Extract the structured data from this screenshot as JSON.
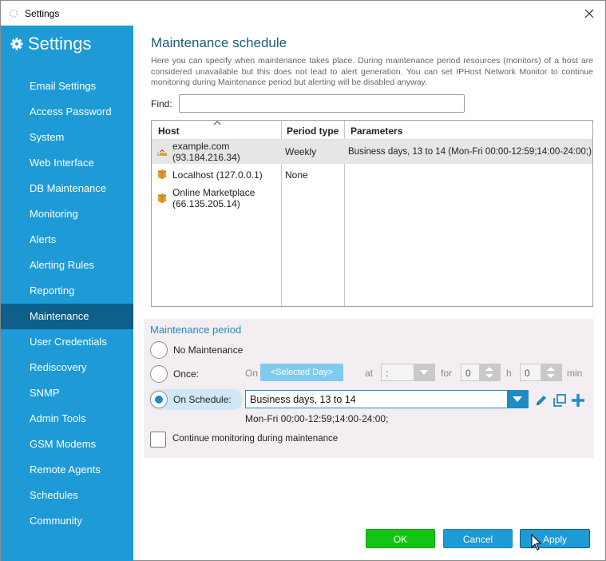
{
  "window": {
    "title": "Settings"
  },
  "sidebar": {
    "title": "Settings",
    "items": [
      {
        "label": "Email Settings"
      },
      {
        "label": "Access Password"
      },
      {
        "label": "System"
      },
      {
        "label": "Web Interface"
      },
      {
        "label": "DB Maintenance"
      },
      {
        "label": "Monitoring"
      },
      {
        "label": "Alerts"
      },
      {
        "label": "Alerting Rules"
      },
      {
        "label": "Reporting"
      },
      {
        "label": "Maintenance",
        "active": true
      },
      {
        "label": "User Credentials"
      },
      {
        "label": "Rediscovery"
      },
      {
        "label": "SNMP"
      },
      {
        "label": "Admin Tools"
      },
      {
        "label": "GSM Modems"
      },
      {
        "label": "Remote Agents"
      },
      {
        "label": "Schedules"
      },
      {
        "label": "Community"
      }
    ]
  },
  "main": {
    "heading": "Maintenance schedule",
    "description": "Here you can specify when maintenance takes place. During maintenance period resources (monitors) of a host are considered unavailable but this does not lead to alert generation. You can set IPHost Network Monitor to continue monitoring during Maintenance period but alerting will be disabled anyway.",
    "find_label": "Find:",
    "find_value": "",
    "table": {
      "columns": [
        "Host",
        "Period type",
        "Parameters"
      ],
      "rows": [
        {
          "host_line1": "example.com",
          "host_line2": "(93.184.216.34)",
          "period_type": "Weekly",
          "parameters": "Business days, 13 to 14 (Mon-Fri 00:00-12:59;14:00-24:00;)",
          "icon": "host-network-icon",
          "selected": true
        },
        {
          "host_line1": "Localhost (127.0.0.1)",
          "host_line2": "",
          "period_type": "None",
          "parameters": "",
          "icon": "server-icon"
        },
        {
          "host_line1": "Online Marketplace",
          "host_line2": "(66.135.205.14)",
          "period_type": "",
          "parameters": "",
          "icon": "server-icon"
        }
      ]
    }
  },
  "period": {
    "title": "Maintenance period",
    "options": {
      "no_maintenance": "No Maintenance",
      "once": "Once:",
      "on_schedule": "On Schedule:"
    },
    "selected": "on_schedule",
    "once_on": "On",
    "once_day": "<Selected Day>",
    "once_at": "at",
    "once_time": ":",
    "once_for": "for",
    "hours_value": "0",
    "hours_unit": "h",
    "minutes_value": "0",
    "minutes_unit": "min",
    "schedule_value": "Business days, 13 to 14",
    "schedule_detail": "Mon-Fri 00:00-12:59;14:00-24:00;",
    "continue_label": "Continue monitoring during maintenance",
    "continue_checked": false
  },
  "buttons": {
    "ok": "OK",
    "cancel": "Cancel",
    "apply": "Apply"
  },
  "colors": {
    "accent": "#1e9ad6",
    "sidebar_active": "#0e5f89",
    "ok_green": "#12c512",
    "heading": "#1a5c7e"
  }
}
